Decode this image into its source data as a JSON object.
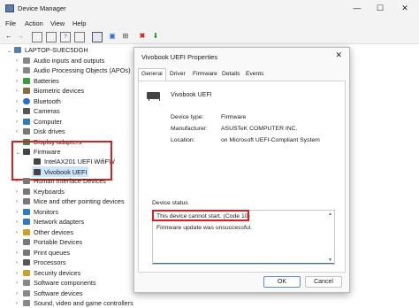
{
  "window": {
    "title": "Device Manager",
    "minimize": "—",
    "maximize": "☐",
    "close": "✕"
  },
  "menu": [
    "File",
    "Action",
    "View",
    "Help"
  ],
  "tree": {
    "root": "LAPTOP-SUEC5DGH",
    "items": [
      "Audio inputs and outputs",
      "Audio Processing Objects (APOs)",
      "Batteries",
      "Biometric devices",
      "Bluetooth",
      "Cameras",
      "Computer",
      "Disk drives",
      "Display adapters",
      "Firmware",
      "IntelAX201 UEFI WifiFW",
      "Vivobook UEFI",
      "Human Interface Devices",
      "Keyboards",
      "Mice and other pointing devices",
      "Monitors",
      "Network adapters",
      "Other devices",
      "Portable Devices",
      "Print queues",
      "Processors",
      "Security devices",
      "Software components",
      "Software devices",
      "Sound, video and game controllers"
    ]
  },
  "dialog": {
    "title": "Vivobook UEFI Properties",
    "close": "✕",
    "tabs": [
      "General",
      "Driver",
      "Firmware",
      "Details",
      "Events"
    ],
    "device_name": "Vivobook UEFI",
    "properties": [
      {
        "label": "Device type:",
        "value": "Firmware"
      },
      {
        "label": "Manufacturer:",
        "value": "ASUSTeK COMPUTER INC."
      },
      {
        "label": "Location:",
        "value": "on Microsoft UEFI-Compliant System"
      }
    ],
    "status_label": "Device status",
    "status_line1": "This device cannot start. (Code 10)",
    "status_line2": "Firmware update was unsuccessful.",
    "ok": "OK",
    "cancel": "Cancel"
  },
  "colors": {
    "highlight_red": "#d91e1e",
    "selection": "#cde5fb"
  }
}
